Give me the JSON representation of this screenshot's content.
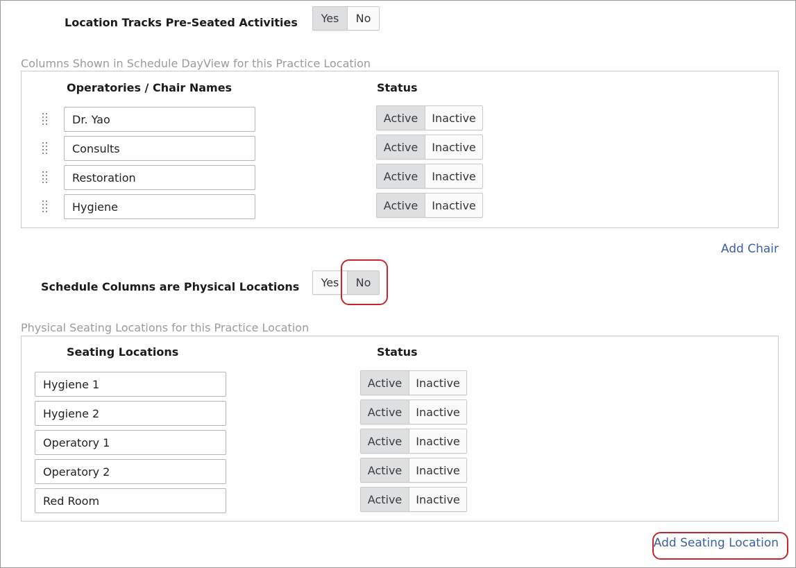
{
  "pre_seated": {
    "label": "Location Tracks Pre-Seated Activities",
    "options": [
      "Yes",
      "No"
    ],
    "selected": "Yes"
  },
  "columns_section": {
    "title": "Columns Shown in Schedule DayView for this Practice Location",
    "name_header": "Operatories / Chair Names",
    "status_header": "Status",
    "rows": [
      {
        "name": "Dr. Yao",
        "status": "Active"
      },
      {
        "name": "Consults",
        "status": "Active"
      },
      {
        "name": "Restoration",
        "status": "Active"
      },
      {
        "name": "Hygiene",
        "status": "Active"
      }
    ],
    "status_options": [
      "Active",
      "Inactive"
    ],
    "add_label": "Add Chair"
  },
  "physical_locations": {
    "label": "Schedule Columns are Physical Locations",
    "options": [
      "Yes",
      "No"
    ],
    "selected": "No"
  },
  "seating_section": {
    "title": "Physical Seating Locations for this Practice Location",
    "name_header": "Seating Locations",
    "status_header": "Status",
    "rows": [
      {
        "name": "Hygiene 1",
        "status": "Active"
      },
      {
        "name": "Hygiene 2",
        "status": "Active"
      },
      {
        "name": "Operatory 1",
        "status": "Active"
      },
      {
        "name": "Operatory 2",
        "status": "Active"
      },
      {
        "name": "Red Room",
        "status": "Active"
      }
    ],
    "status_options": [
      "Active",
      "Inactive"
    ],
    "add_label": "Add Seating Location"
  },
  "colors": {
    "selected_bg": "#dedfe1",
    "link": "#3b5fa0",
    "callout": "#c8252c",
    "section_title": "#9b9b9b"
  }
}
